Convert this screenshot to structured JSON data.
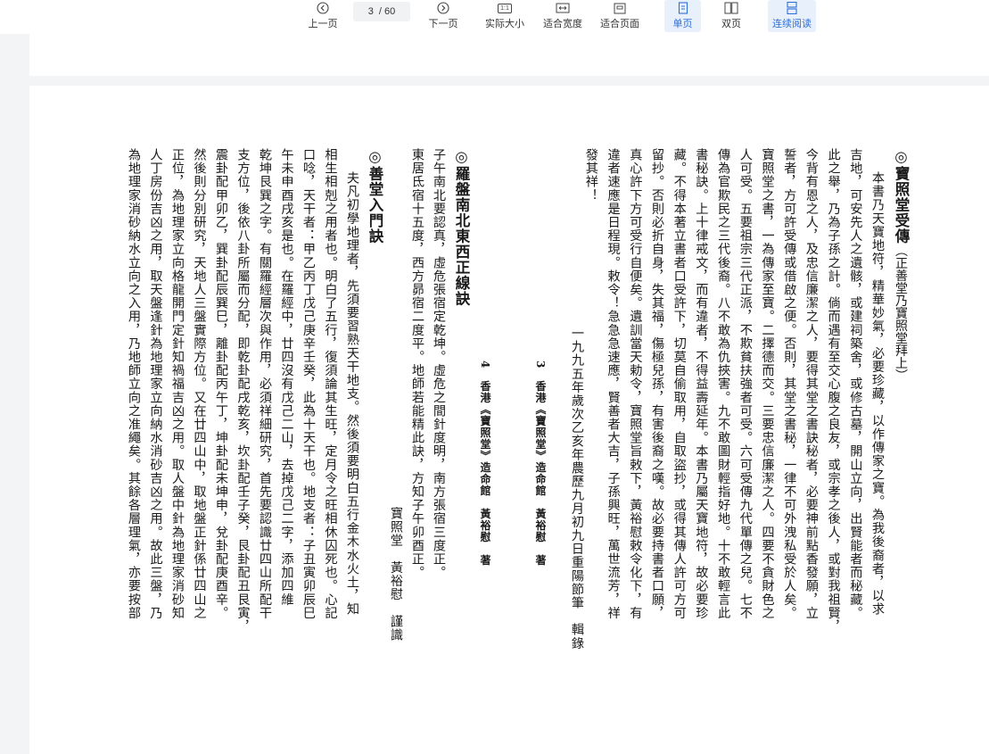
{
  "toolbar": {
    "prev_label": "上一页",
    "next_label": "下一页",
    "page_current": "3",
    "page_total": "/ 60",
    "actual_size_label": "实际大小",
    "actual_size_icon_text": "1:1",
    "fit_width_label": "适合宽度",
    "fit_page_label": "适合页面",
    "single_page_label": "单页",
    "double_page_label": "双页",
    "continuous_label": "连续阅读"
  },
  "document": {
    "section1": {
      "title": "◎寶照堂受傳",
      "subtitle": "（正善堂乃寶照堂拜上）",
      "lines": [
        "本書乃天寶地符，精華妙氣，必要珍藏，以作傳家之寶。為我後裔者，以求",
        "吉地，可安先人之遺骸，或建祠築舍，或修古墓，開山立向，出賢能者而秘藏。",
        "此之舉，乃為子孫之計。倘而遇有至交心腹之良友，或宗孝之後人，或對我祖賢，",
        "今背有恩之人，及忠信廉潔之人，要得其堂之書訣秘者，必要神前點香發願，立",
        "誓者，方可許受傳或借啟之便。否則，其堂之書秘，一律不可外洩私受於人矣。",
        "寶照堂之書，一為傳家至寶。二擇德而交。三要忠信廉潔之人。四要不貪財色之",
        "人可受。五要祖宗三代正派，不欺貧扶強者可受。六可受傳九代單傳之兒。七不",
        "傳為官欺民之三代後裔。八不敢為仇挾害。九不敢圖財輕指好地。十不敢輕言此",
        "書秘訣。上十律戒文，而有違者，不得益壽延年。本書乃屬天寶地符，故必要珍",
        "藏。不得本著立書者口受許下，切莫自偷取用，自取盜抄，或得其傳人許可方可",
        "留抄。否則必折自身，失其福，傷極兒孫，有害後裔之嘆。故必要持書者口願，",
        "真心許下方可受行自便矣。遺訓當天勅令，寶照堂旨敕下，黃裕慰敕令化下，有",
        "違者速應是日程現。敕令！急急急速應，賢善者大吉，子孫興旺，萬世流芳，祥",
        "發其祥！"
      ],
      "date_line": "一九九五年歲次乙亥年農歷九月初九日重陽節筆　輯錄"
    },
    "notes": [
      "3　香港《寶照堂》造命館　黃裕慰　著",
      "4　香港《寶照堂》造命館　黃裕慰　著"
    ],
    "section2": {
      "title": "◎羅盤南北東西正線訣",
      "lines": [
        "子午南北要認真，虛危張宿定乾坤。虛危之間針度明，南方張宿三度正。",
        "東居氐宿十五度，西方昴宿二度平。地師若能精此訣，方知子午卯酉正。"
      ],
      "signature": "寶照堂　黃裕慰　謹識"
    },
    "section3": {
      "title": "◎善堂入門訣",
      "lines": [
        "夫凡初學地理者，先須要習熟天干地支。然後須要明白五行金木水火土，知",
        "相生相剋之用者也。明白了五行，復須論其生旺，定月令之旺相休囚死也。心記",
        "口唸，天干者：甲乙丙丁戊己庚辛壬癸，此為十天干也。地支者：子丑寅卯辰巳",
        "午未申酉戌亥是也。在羅經中，廿四沒有戊己二山，去掉戊己二字，添加四維",
        "乾坤艮巽之字。有關羅經層次與作用，必須祥細研究，首先要認識廿四山所配干",
        "支方位，後依八卦所屬而分配，即乾卦配戌乾亥，坎卦配壬子癸，艮卦配丑艮寅，",
        "震卦配甲卯乙，巽卦配辰巽巳，離卦配丙午丁，坤卦配未坤申，兌卦配庚酉辛。",
        "然後則分別研究，天地人三盤實際方位。又在廿四山中，取地盤正針係廿四山之",
        "正位，為地理家立向格龍開門定針知禍福吉凶之用。取人盤中針為地理家消砂知",
        "人丁房份吉凶之用，取天盤逢針為地理家立向納水消砂吉凶之用。故此三盤，乃",
        "為地理家消砂納水立向之入用，乃地師立向之准繩矣。其餘各層理氣，亦要按部"
      ]
    }
  }
}
